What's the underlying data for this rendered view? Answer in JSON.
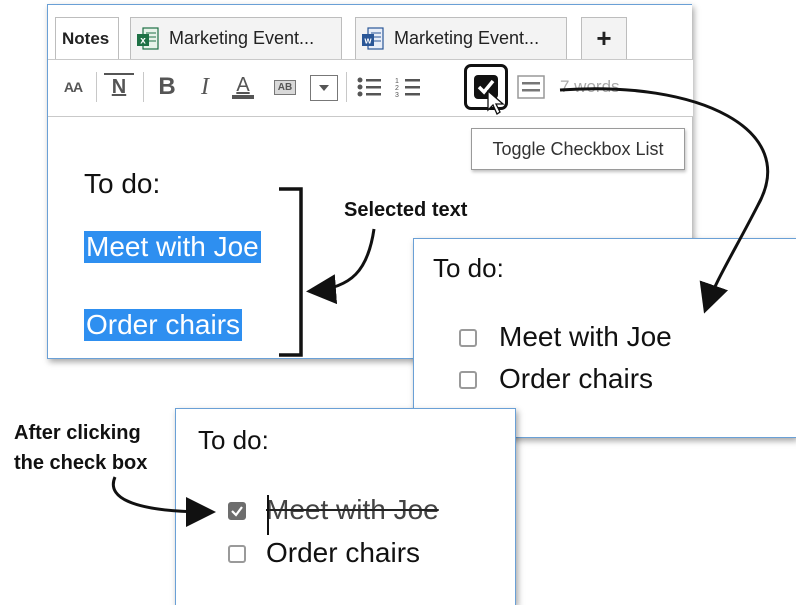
{
  "tabs": {
    "notes": "Notes",
    "excel_doc": "Marketing Event...",
    "word_doc": "Marketing Event...",
    "add": "+"
  },
  "toolbar": {
    "font_size": "AA",
    "text_style": "N",
    "bold": "B",
    "italic": "I",
    "font_color": "A",
    "highlight": "AB",
    "word_count": "7 words"
  },
  "tooltip": "Toggle Checkbox List",
  "editor": {
    "heading": "To do:",
    "item1": "Meet with Joe",
    "item2": "Order chairs"
  },
  "annotations": {
    "selected": "Selected text",
    "after_line1": "After clicking",
    "after_line2": "the check box"
  },
  "result_list": {
    "heading": "To do:",
    "items": [
      {
        "label": "Meet with Joe",
        "checked": false
      },
      {
        "label": "Order chairs",
        "checked": false
      }
    ]
  },
  "after_list": {
    "heading": "To do:",
    "items": [
      {
        "label": "Meet with Joe",
        "checked": true
      },
      {
        "label": "Order chairs",
        "checked": false
      }
    ]
  },
  "colors": {
    "selection": "#2e8ff0",
    "panel_border": "#6aa0d6",
    "excel_icon": "#1e7145",
    "word_icon": "#2b5797"
  }
}
